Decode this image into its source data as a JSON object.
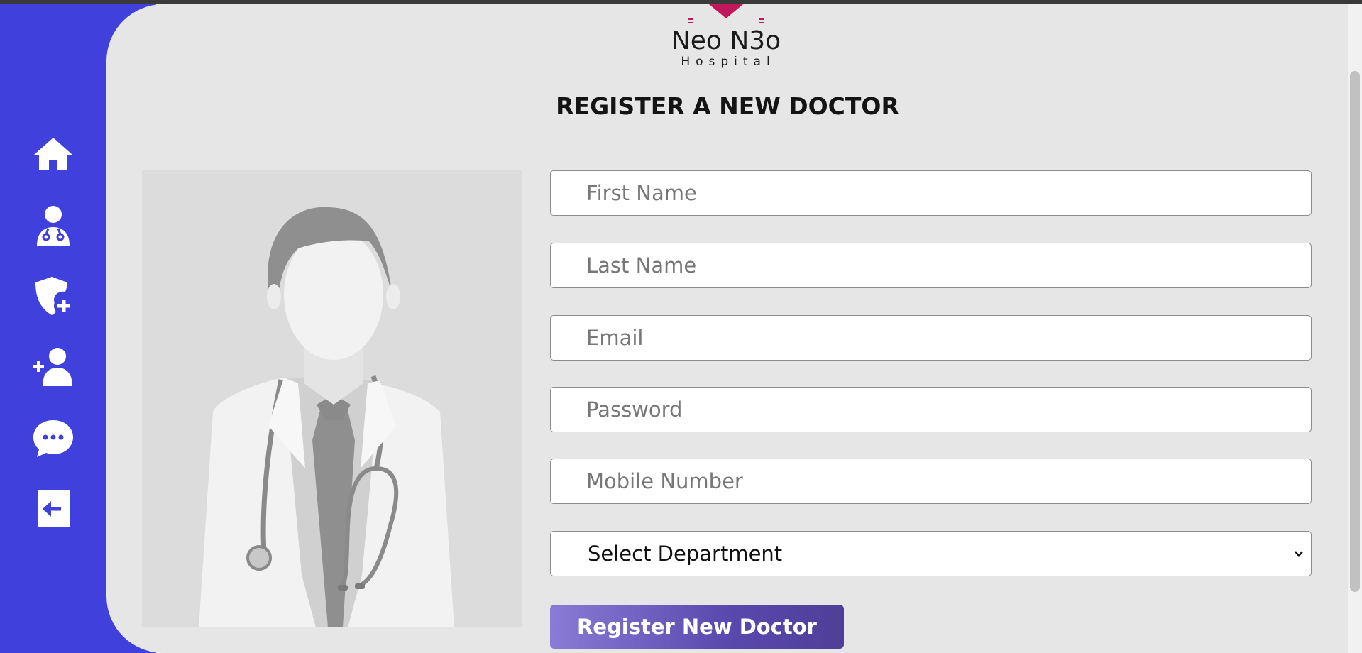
{
  "logo": {
    "name": "Neo N3o",
    "subtitle": "Hospital"
  },
  "page": {
    "title": "REGISTER A NEW DOCTOR"
  },
  "sidebar": {
    "items": [
      {
        "icon": "home-icon"
      },
      {
        "icon": "doctor-icon"
      },
      {
        "icon": "shield-plus-icon"
      },
      {
        "icon": "add-user-icon"
      },
      {
        "icon": "chat-icon"
      },
      {
        "icon": "logout-icon"
      }
    ]
  },
  "form": {
    "first_name_placeholder": "First Name",
    "last_name_placeholder": "Last Name",
    "email_placeholder": "Email",
    "password_placeholder": "Password",
    "mobile_placeholder": "Mobile Number",
    "department_selected": "Select Department",
    "submit_label": "Register New Doctor"
  },
  "colors": {
    "sidebar": "#4040dc",
    "panel": "#e6e6e6",
    "brand_accent": "#c2185b",
    "button_start": "#8a7bd6",
    "button_end": "#4f3f98"
  }
}
